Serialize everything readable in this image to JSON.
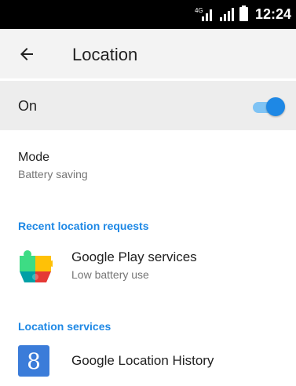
{
  "status_bar": {
    "network_type": "4G",
    "time": "12:24"
  },
  "app_bar": {
    "title": "Location"
  },
  "master_switch": {
    "label": "On",
    "checked": true
  },
  "mode": {
    "title": "Mode",
    "summary": "Battery saving"
  },
  "recent_requests": {
    "header": "Recent location requests",
    "items": [
      {
        "title": "Google Play services",
        "summary": "Low battery use",
        "icon": "google-play-services-icon"
      }
    ]
  },
  "location_services": {
    "header": "Location services",
    "items": [
      {
        "title": "Google Location History",
        "icon": "google-location-history-icon",
        "icon_letter": "8"
      }
    ]
  },
  "colors": {
    "accent": "#1e88e5",
    "app_bar_bg": "#f3f3f3",
    "switch_row_bg": "#ededed"
  }
}
